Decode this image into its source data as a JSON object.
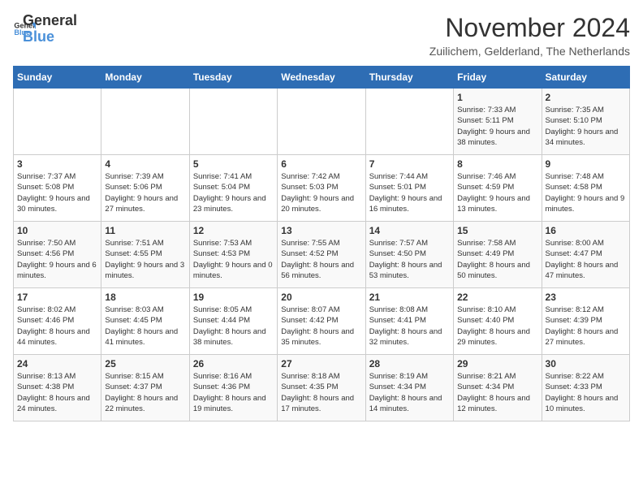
{
  "logo": {
    "text_general": "General",
    "text_blue": "Blue"
  },
  "title": "November 2024",
  "location": "Zuilichem, Gelderland, The Netherlands",
  "days_of_week": [
    "Sunday",
    "Monday",
    "Tuesday",
    "Wednesday",
    "Thursday",
    "Friday",
    "Saturday"
  ],
  "weeks": [
    [
      {
        "day": "",
        "info": ""
      },
      {
        "day": "",
        "info": ""
      },
      {
        "day": "",
        "info": ""
      },
      {
        "day": "",
        "info": ""
      },
      {
        "day": "",
        "info": ""
      },
      {
        "day": "1",
        "info": "Sunrise: 7:33 AM\nSunset: 5:11 PM\nDaylight: 9 hours and 38 minutes."
      },
      {
        "day": "2",
        "info": "Sunrise: 7:35 AM\nSunset: 5:10 PM\nDaylight: 9 hours and 34 minutes."
      }
    ],
    [
      {
        "day": "3",
        "info": "Sunrise: 7:37 AM\nSunset: 5:08 PM\nDaylight: 9 hours and 30 minutes."
      },
      {
        "day": "4",
        "info": "Sunrise: 7:39 AM\nSunset: 5:06 PM\nDaylight: 9 hours and 27 minutes."
      },
      {
        "day": "5",
        "info": "Sunrise: 7:41 AM\nSunset: 5:04 PM\nDaylight: 9 hours and 23 minutes."
      },
      {
        "day": "6",
        "info": "Sunrise: 7:42 AM\nSunset: 5:03 PM\nDaylight: 9 hours and 20 minutes."
      },
      {
        "day": "7",
        "info": "Sunrise: 7:44 AM\nSunset: 5:01 PM\nDaylight: 9 hours and 16 minutes."
      },
      {
        "day": "8",
        "info": "Sunrise: 7:46 AM\nSunset: 4:59 PM\nDaylight: 9 hours and 13 minutes."
      },
      {
        "day": "9",
        "info": "Sunrise: 7:48 AM\nSunset: 4:58 PM\nDaylight: 9 hours and 9 minutes."
      }
    ],
    [
      {
        "day": "10",
        "info": "Sunrise: 7:50 AM\nSunset: 4:56 PM\nDaylight: 9 hours and 6 minutes."
      },
      {
        "day": "11",
        "info": "Sunrise: 7:51 AM\nSunset: 4:55 PM\nDaylight: 9 hours and 3 minutes."
      },
      {
        "day": "12",
        "info": "Sunrise: 7:53 AM\nSunset: 4:53 PM\nDaylight: 9 hours and 0 minutes."
      },
      {
        "day": "13",
        "info": "Sunrise: 7:55 AM\nSunset: 4:52 PM\nDaylight: 8 hours and 56 minutes."
      },
      {
        "day": "14",
        "info": "Sunrise: 7:57 AM\nSunset: 4:50 PM\nDaylight: 8 hours and 53 minutes."
      },
      {
        "day": "15",
        "info": "Sunrise: 7:58 AM\nSunset: 4:49 PM\nDaylight: 8 hours and 50 minutes."
      },
      {
        "day": "16",
        "info": "Sunrise: 8:00 AM\nSunset: 4:47 PM\nDaylight: 8 hours and 47 minutes."
      }
    ],
    [
      {
        "day": "17",
        "info": "Sunrise: 8:02 AM\nSunset: 4:46 PM\nDaylight: 8 hours and 44 minutes."
      },
      {
        "day": "18",
        "info": "Sunrise: 8:03 AM\nSunset: 4:45 PM\nDaylight: 8 hours and 41 minutes."
      },
      {
        "day": "19",
        "info": "Sunrise: 8:05 AM\nSunset: 4:44 PM\nDaylight: 8 hours and 38 minutes."
      },
      {
        "day": "20",
        "info": "Sunrise: 8:07 AM\nSunset: 4:42 PM\nDaylight: 8 hours and 35 minutes."
      },
      {
        "day": "21",
        "info": "Sunrise: 8:08 AM\nSunset: 4:41 PM\nDaylight: 8 hours and 32 minutes."
      },
      {
        "day": "22",
        "info": "Sunrise: 8:10 AM\nSunset: 4:40 PM\nDaylight: 8 hours and 29 minutes."
      },
      {
        "day": "23",
        "info": "Sunrise: 8:12 AM\nSunset: 4:39 PM\nDaylight: 8 hours and 27 minutes."
      }
    ],
    [
      {
        "day": "24",
        "info": "Sunrise: 8:13 AM\nSunset: 4:38 PM\nDaylight: 8 hours and 24 minutes."
      },
      {
        "day": "25",
        "info": "Sunrise: 8:15 AM\nSunset: 4:37 PM\nDaylight: 8 hours and 22 minutes."
      },
      {
        "day": "26",
        "info": "Sunrise: 8:16 AM\nSunset: 4:36 PM\nDaylight: 8 hours and 19 minutes."
      },
      {
        "day": "27",
        "info": "Sunrise: 8:18 AM\nSunset: 4:35 PM\nDaylight: 8 hours and 17 minutes."
      },
      {
        "day": "28",
        "info": "Sunrise: 8:19 AM\nSunset: 4:34 PM\nDaylight: 8 hours and 14 minutes."
      },
      {
        "day": "29",
        "info": "Sunrise: 8:21 AM\nSunset: 4:34 PM\nDaylight: 8 hours and 12 minutes."
      },
      {
        "day": "30",
        "info": "Sunrise: 8:22 AM\nSunset: 4:33 PM\nDaylight: 8 hours and 10 minutes."
      }
    ]
  ]
}
